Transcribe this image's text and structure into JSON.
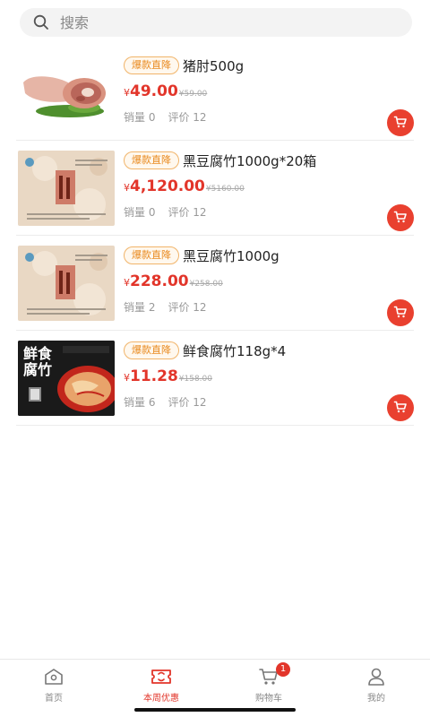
{
  "search": {
    "placeholder": "搜索"
  },
  "products": [
    {
      "badge": "爆款直降",
      "title": "猪肘500g",
      "currency": "¥",
      "price": "49.00",
      "old_price": "¥59.00",
      "sales": "销量 0",
      "reviews": "评价 12",
      "image": "pork-knuckle-image"
    },
    {
      "badge": "爆款直降",
      "title": "黑豆腐竹1000g*20箱",
      "currency": "¥",
      "price": "4,120.00",
      "old_price": "¥5160.00",
      "sales": "销量 0",
      "reviews": "评价 12",
      "image": "tofu-skin-box-image"
    },
    {
      "badge": "爆款直降",
      "title": "黑豆腐竹1000g",
      "currency": "¥",
      "price": "228.00",
      "old_price": "¥258.00",
      "sales": "销量 2",
      "reviews": "评价 12",
      "image": "tofu-skin-box-image"
    },
    {
      "badge": "爆款直降",
      "title": "鲜食腐竹118g*4",
      "currency": "¥",
      "price": "11.28",
      "old_price": "¥158.00",
      "sales": "销量 6",
      "reviews": "评价 12",
      "image": "fresh-tofu-skin-package-image",
      "image_text": "鲜食腐竹"
    }
  ],
  "tabbar": {
    "tabs": [
      {
        "label": "首页",
        "icon": "home-icon",
        "active": false
      },
      {
        "label": "本周优惠",
        "icon": "coupon-icon",
        "active": true
      },
      {
        "label": "购物车",
        "icon": "cart-icon",
        "active": false,
        "badge": "1"
      },
      {
        "label": "我的",
        "icon": "user-icon",
        "active": false
      }
    ]
  },
  "colors": {
    "accent": "#e2352a",
    "badge_border": "#f1b46a",
    "badge_text": "#e98a1f",
    "muted": "#999999"
  }
}
